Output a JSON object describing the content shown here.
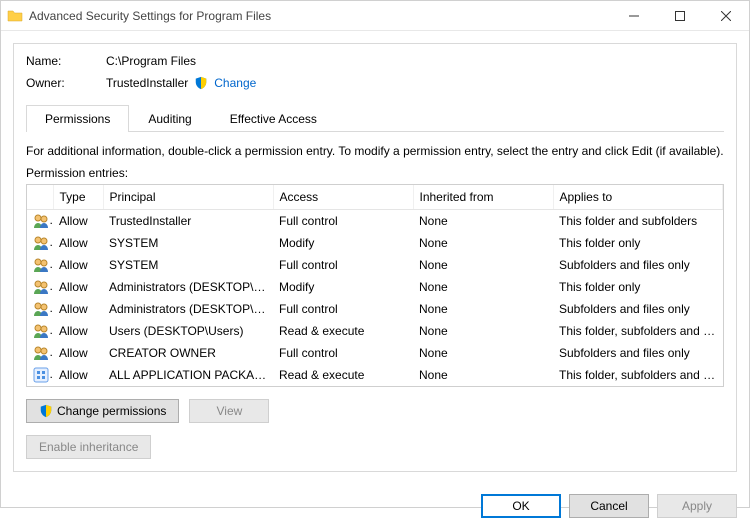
{
  "window": {
    "title": "Advanced Security Settings for Program Files"
  },
  "header": {
    "name_label": "Name:",
    "name_value": "C:\\Program Files",
    "owner_label": "Owner:",
    "owner_value": "TrustedInstaller",
    "change_link": "Change"
  },
  "tabs": {
    "permissions": "Permissions",
    "auditing": "Auditing",
    "effective": "Effective Access"
  },
  "info_text": "For additional information, double-click a permission entry. To modify a permission entry, select the entry and click Edit (if available).",
  "perm_entries_label": "Permission entries:",
  "columns": {
    "type": "Type",
    "principal": "Principal",
    "access": "Access",
    "inherited": "Inherited from",
    "applies": "Applies to"
  },
  "rows": [
    {
      "icon": "users",
      "type": "Allow",
      "principal": "TrustedInstaller",
      "access": "Full control",
      "inherited": "None",
      "applies": "This folder and subfolders"
    },
    {
      "icon": "users",
      "type": "Allow",
      "principal": "SYSTEM",
      "access": "Modify",
      "inherited": "None",
      "applies": "This folder only"
    },
    {
      "icon": "users",
      "type": "Allow",
      "principal": "SYSTEM",
      "access": "Full control",
      "inherited": "None",
      "applies": "Subfolders and files only"
    },
    {
      "icon": "users",
      "type": "Allow",
      "principal": "Administrators (DESKTOP\\Ad...",
      "access": "Modify",
      "inherited": "None",
      "applies": "This folder only"
    },
    {
      "icon": "users",
      "type": "Allow",
      "principal": "Administrators (DESKTOP\\Ad...",
      "access": "Full control",
      "inherited": "None",
      "applies": "Subfolders and files only"
    },
    {
      "icon": "users",
      "type": "Allow",
      "principal": "Users (DESKTOP\\Users)",
      "access": "Read & execute",
      "inherited": "None",
      "applies": "This folder, subfolders and files"
    },
    {
      "icon": "users",
      "type": "Allow",
      "principal": "CREATOR OWNER",
      "access": "Full control",
      "inherited": "None",
      "applies": "Subfolders and files only"
    },
    {
      "icon": "app",
      "type": "Allow",
      "principal": "ALL APPLICATION PACKAGES",
      "access": "Read & execute",
      "inherited": "None",
      "applies": "This folder, subfolders and files"
    }
  ],
  "buttons": {
    "change_permissions": "Change permissions",
    "view": "View",
    "enable_inheritance": "Enable inheritance",
    "ok": "OK",
    "cancel": "Cancel",
    "apply": "Apply"
  }
}
